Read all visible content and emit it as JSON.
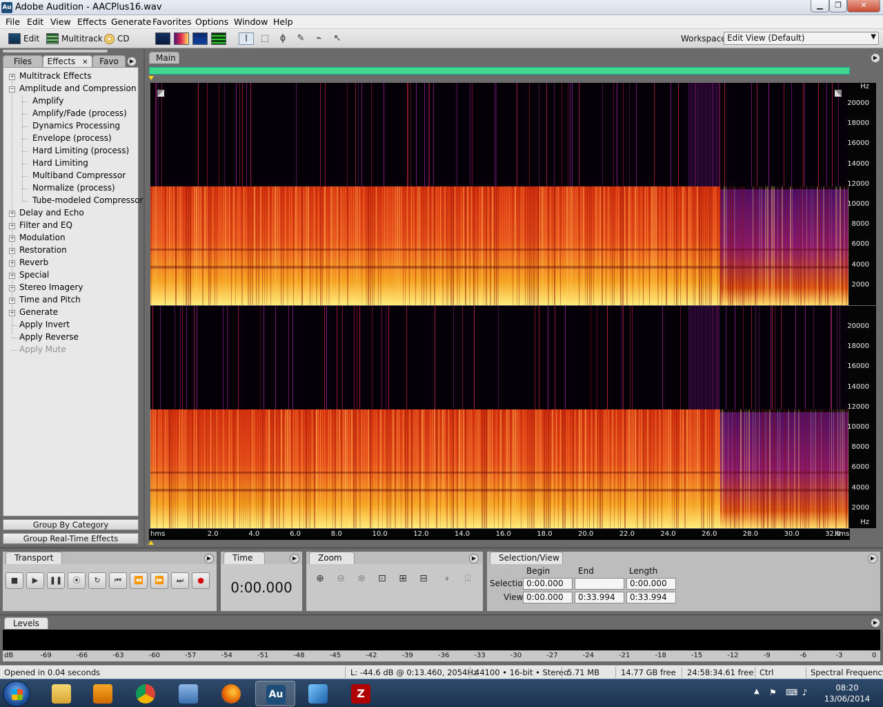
{
  "window": {
    "title": "Adobe Audition - AACPlus16.wav",
    "app_icon": "Au"
  },
  "menu": [
    "File",
    "Edit",
    "View",
    "Effects",
    "Generate",
    "Favorites",
    "Options",
    "Window",
    "Help"
  ],
  "toolbar": {
    "edit_label": "Edit",
    "multitrack_label": "Multitrack",
    "cd_label": "CD",
    "workspace_label": "Workspace:",
    "workspace_value": "Edit View (Default)"
  },
  "left_panel": {
    "tabs": [
      "Files",
      "Effects",
      "Favo"
    ],
    "tree": [
      {
        "label": "Multitrack Effects",
        "level": 0,
        "expander": "+"
      },
      {
        "label": "Amplitude and Compression",
        "level": 0,
        "expander": "−"
      },
      {
        "label": "Amplify",
        "level": 1
      },
      {
        "label": "Amplify/Fade (process)",
        "level": 1
      },
      {
        "label": "Dynamics Processing",
        "level": 1
      },
      {
        "label": "Envelope (process)",
        "level": 1
      },
      {
        "label": "Hard Limiting (process)",
        "level": 1
      },
      {
        "label": "Hard Limiting",
        "level": 1
      },
      {
        "label": "Multiband Compressor",
        "level": 1
      },
      {
        "label": "Normalize (process)",
        "level": 1
      },
      {
        "label": "Tube-modeled Compressor",
        "level": 1
      },
      {
        "label": "Delay and Echo",
        "level": 0,
        "expander": "+"
      },
      {
        "label": "Filter and EQ",
        "level": 0,
        "expander": "+"
      },
      {
        "label": "Modulation",
        "level": 0,
        "expander": "+"
      },
      {
        "label": "Restoration",
        "level": 0,
        "expander": "+"
      },
      {
        "label": "Reverb",
        "level": 0,
        "expander": "+"
      },
      {
        "label": "Special",
        "level": 0,
        "expander": "+"
      },
      {
        "label": "Stereo Imagery",
        "level": 0,
        "expander": "+"
      },
      {
        "label": "Time and Pitch",
        "level": 0,
        "expander": "+"
      },
      {
        "label": "Generate",
        "level": 0,
        "expander": "+"
      },
      {
        "label": "Apply Invert",
        "level": 0
      },
      {
        "label": "Apply Reverse",
        "level": 0
      },
      {
        "label": "Apply Mute",
        "level": 0,
        "disabled": true
      }
    ],
    "group_by_category": "Group By Category",
    "group_realtime": "Group Real-Time Effects"
  },
  "main": {
    "tab": "Main",
    "freq_unit": "Hz",
    "freq_labels": [
      "20000",
      "18000",
      "16000",
      "14000",
      "12000",
      "10000",
      "8000",
      "6000",
      "4000",
      "2000"
    ],
    "time_unit": "hms",
    "time_labels": [
      "2.0",
      "4.0",
      "6.0",
      "8.0",
      "10.0",
      "12.0",
      "14.0",
      "16.0",
      "18.0",
      "20.0",
      "22.0",
      "24.0",
      "26.0",
      "28.0",
      "30.0",
      "32.0"
    ]
  },
  "transport": {
    "tab": "Transport"
  },
  "time_panel": {
    "tab": "Time",
    "value": "0:00.000"
  },
  "zoom_panel": {
    "tab": "Zoom"
  },
  "selection_view": {
    "tab": "Selection/View",
    "col_begin": "Begin",
    "col_end": "End",
    "col_length": "Length",
    "row_selection": "Selection",
    "row_view": "View",
    "sel_begin": "0:00.000",
    "sel_end": "",
    "sel_length": "0:00.000",
    "view_begin": "0:00.000",
    "view_end": "0:33.994",
    "view_length": "0:33.994"
  },
  "levels": {
    "tab": "Levels",
    "db_labels": [
      "dB",
      "-69",
      "-66",
      "-63",
      "-60",
      "-57",
      "-54",
      "-51",
      "-48",
      "-45",
      "-42",
      "-39",
      "-36",
      "-33",
      "-30",
      "-27",
      "-24",
      "-21",
      "-18",
      "-15",
      "-12",
      "-9",
      "-6",
      "-3",
      "0"
    ]
  },
  "status": {
    "opened": "Opened in 0.04 seconds",
    "cursor": "L: -44.6 dB @   0:13.460, 2054Hz",
    "format": "44100 • 16-bit • Stereo",
    "size": "5.71 MB",
    "free_space": "14.77 GB free",
    "free_time": "24:58:34.61 free",
    "modifier": "Ctrl",
    "view_mode": "Spectral Frequency"
  },
  "taskbar": {
    "time": "08:20",
    "date": "13/06/2014",
    "audition_icon": "Au"
  },
  "colors": {
    "overview": "#3fd98c",
    "spectro_hot": "#ffe066",
    "spectro_mid": "#e03010",
    "spectro_low": "#6a1a8a"
  }
}
